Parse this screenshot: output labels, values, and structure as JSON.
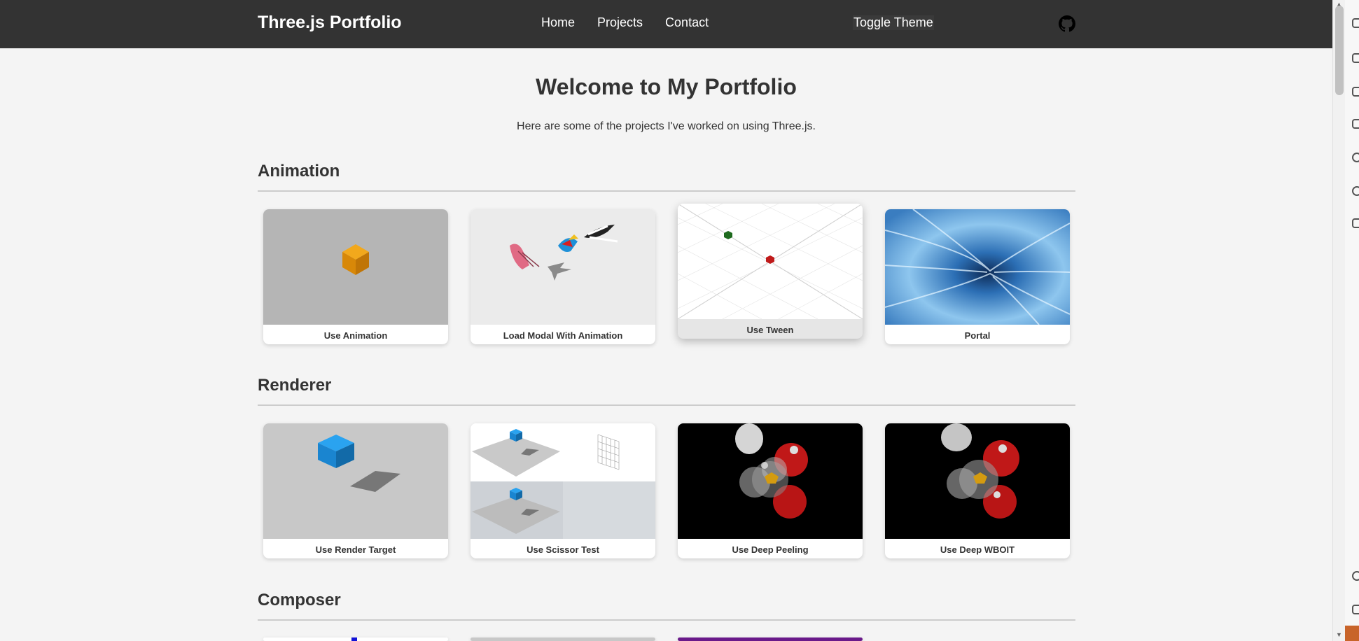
{
  "navbar": {
    "brand": "Three.js Portfolio",
    "links": [
      "Home",
      "Projects",
      "Contact"
    ],
    "toggle": "Toggle Theme",
    "github_icon": "github-icon"
  },
  "hero": {
    "title": "Welcome to My Portfolio",
    "subtitle": "Here are some of the projects I've worked on using Three.js."
  },
  "sections": [
    {
      "title": "Animation",
      "cards": [
        "Use Animation",
        "Load Modal With Animation",
        "Use Tween",
        "Portal"
      ]
    },
    {
      "title": "Renderer",
      "cards": [
        "Use Render Target",
        "Use Scissor Test",
        "Use Deep Peeling",
        "Use Deep WBOIT"
      ]
    },
    {
      "title": "Composer",
      "cards": []
    }
  ],
  "colors": {
    "navbar": "#333333",
    "background": "#f4f4f4",
    "text": "#333333"
  }
}
